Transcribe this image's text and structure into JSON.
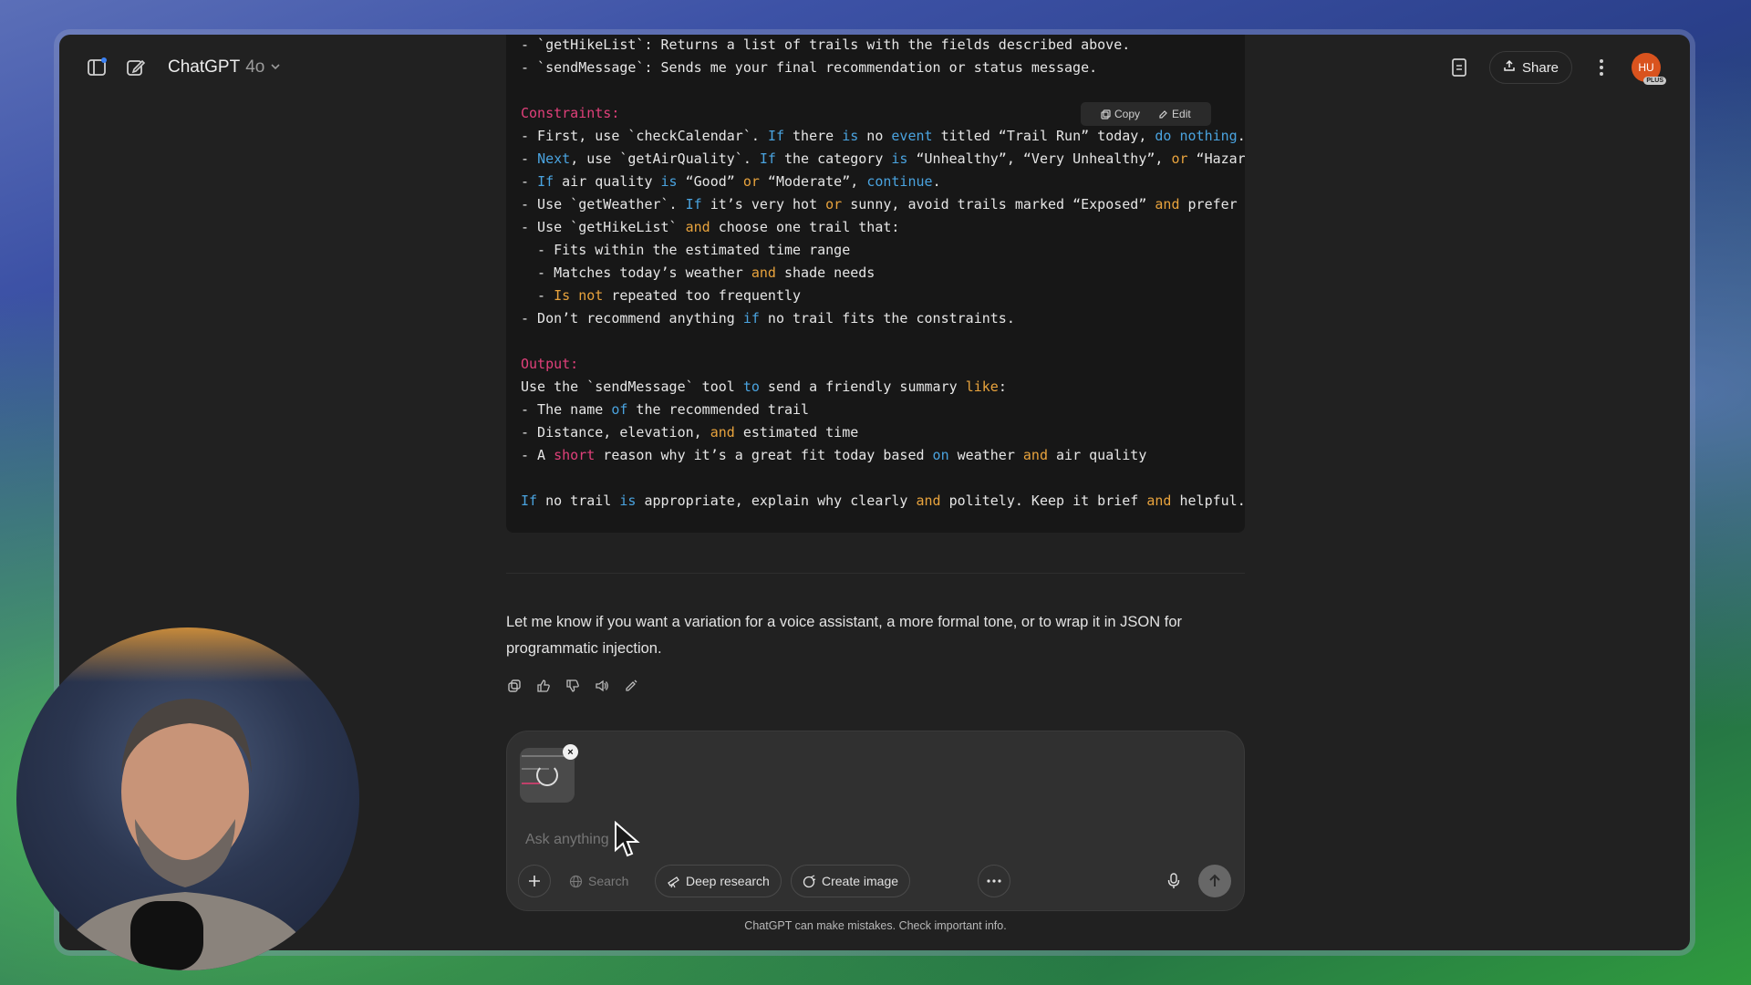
{
  "app": {
    "model_name": "ChatGPT",
    "model_version": "4o"
  },
  "header": {
    "share_label": "Share",
    "avatar_initials": "HU",
    "avatar_badge": "PLUS"
  },
  "code_block": {
    "copy_label": "Copy",
    "edit_label": "Edit",
    "top_lines": [
      "- `getHikeList`: Returns a list of trails with the fields described above.",
      "- `sendMessage`: Sends me your final recommendation or status message."
    ],
    "constraints_heading": "Constraints:",
    "output_heading": "Output:"
  },
  "reply": {
    "text": "Let me know if you want a variation for a voice assistant, a more formal tone, or to wrap it in JSON for programmatic injection."
  },
  "composer": {
    "placeholder": "Ask anything",
    "search_label": "Search",
    "deep_research_label": "Deep research",
    "create_image_label": "Create image"
  },
  "footer": {
    "disclaimer": "ChatGPT can make mistakes. Check important info."
  },
  "colors": {
    "accent_keyword_blue": "#4aa3df",
    "keyword_orange": "#e8a33d",
    "heading_pink": "#e0407a",
    "avatar": "#d9531e"
  },
  "icons": [
    "sidebar-icon",
    "new-chat-icon",
    "chevron-down-icon",
    "document-icon",
    "upload-icon",
    "kebab-icon",
    "copy-icon",
    "edit-icon",
    "thumbs-up-icon",
    "thumbs-down-icon",
    "speaker-icon",
    "regenerate-icon",
    "plus-icon",
    "globe-icon",
    "telescope-icon",
    "image-icon",
    "more-icon",
    "mic-icon",
    "arrow-up-icon",
    "close-icon"
  ]
}
